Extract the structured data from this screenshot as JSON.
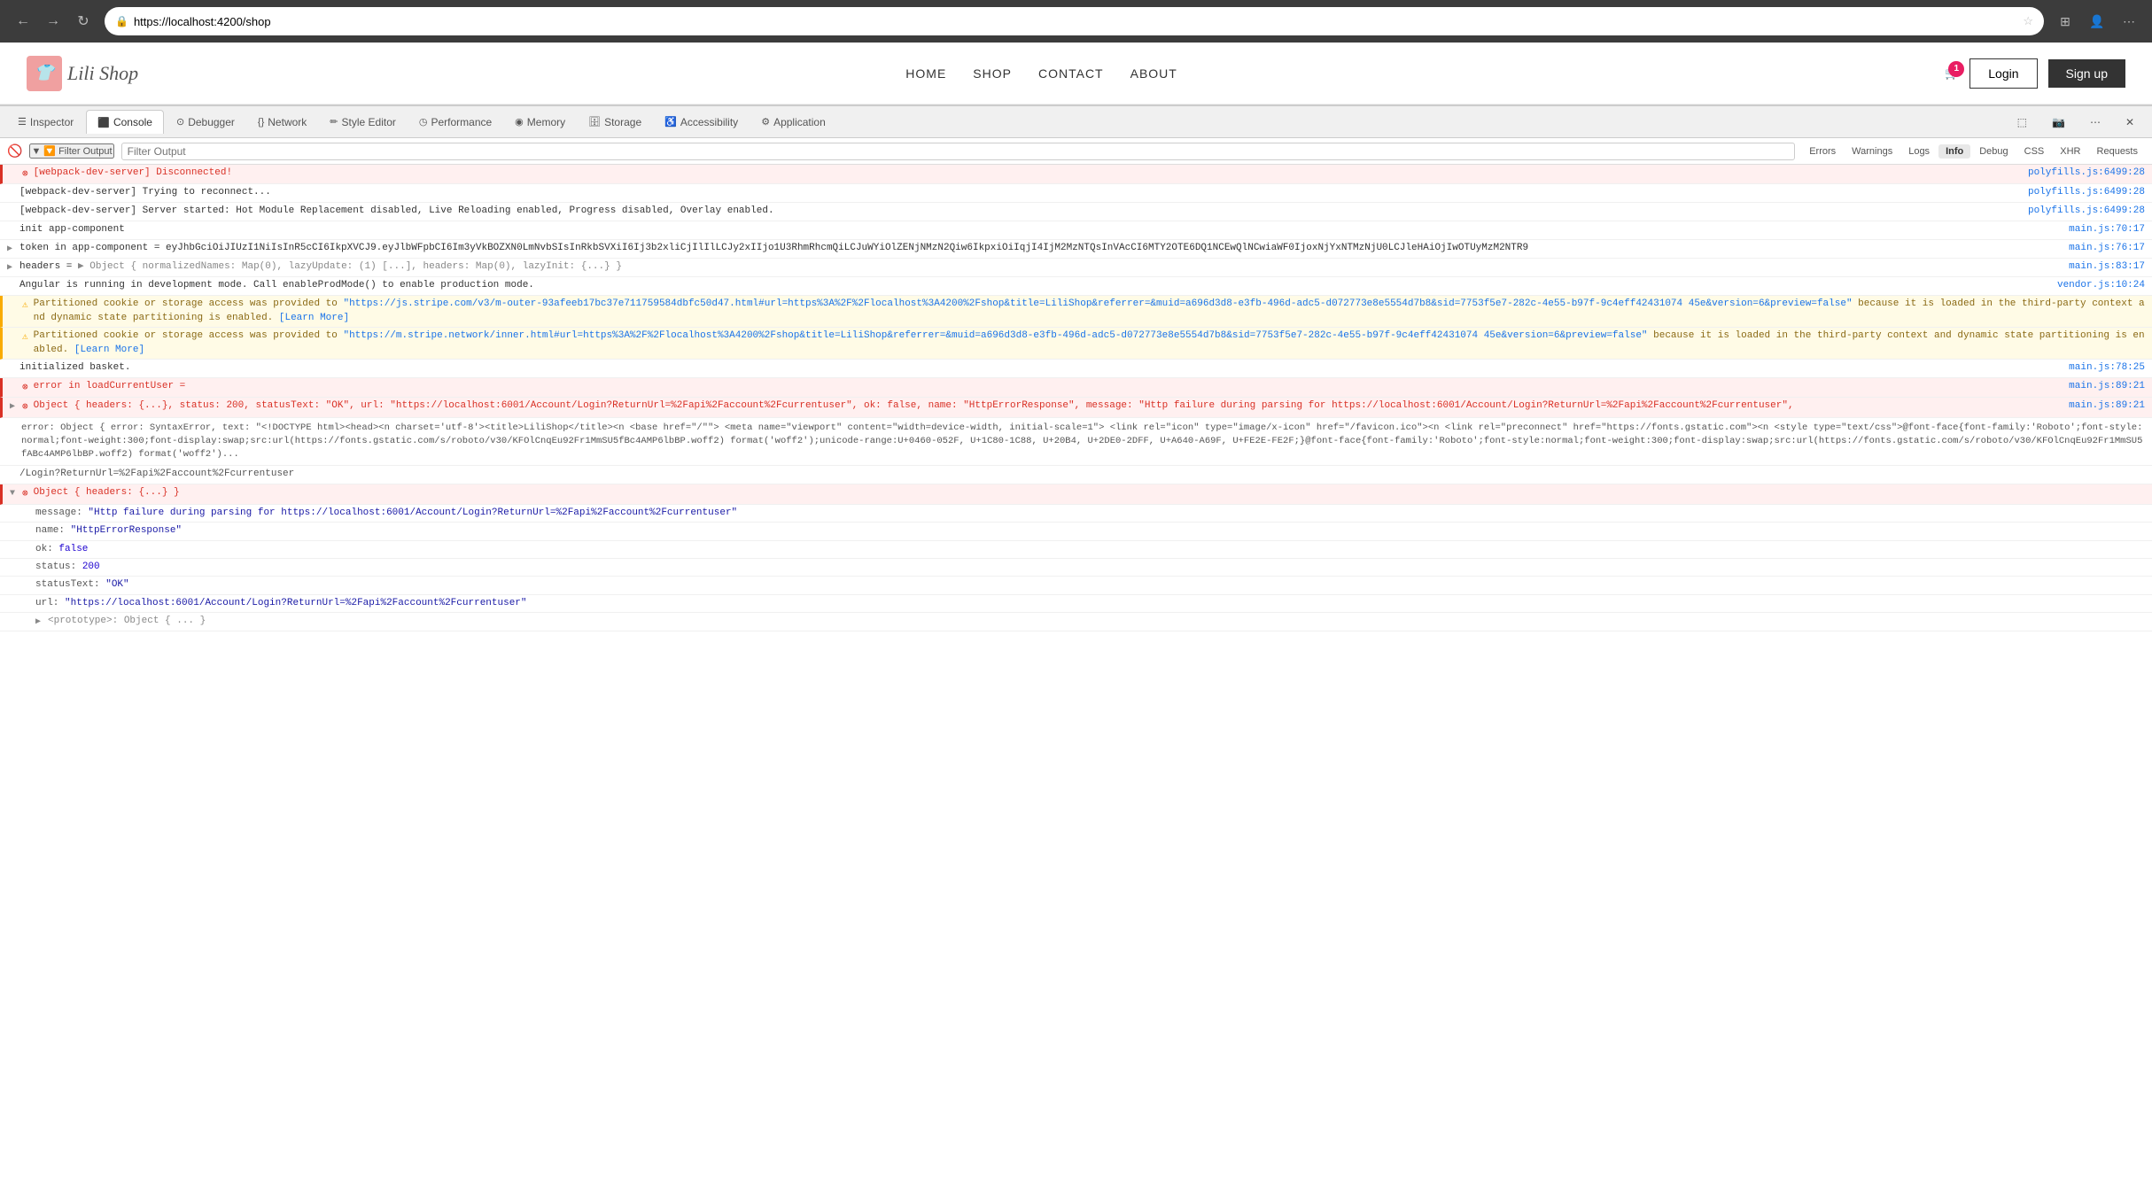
{
  "browser": {
    "url": "https://localhost:4200/shop",
    "back_label": "←",
    "forward_label": "→",
    "refresh_label": "↻",
    "star_label": "☆"
  },
  "site": {
    "logo_text": "Lili Shop",
    "logo_icon": "👕",
    "nav_items": [
      "HOME",
      "SHOP",
      "CONTACT",
      "ABOUT"
    ],
    "cart_count": "1",
    "login_label": "Login",
    "signup_label": "Sign up"
  },
  "devtools": {
    "tabs": [
      {
        "id": "inspector",
        "label": "Inspector",
        "icon": "☰"
      },
      {
        "id": "console",
        "label": "Console",
        "icon": "⬛",
        "active": true
      },
      {
        "id": "debugger",
        "label": "Debugger",
        "icon": "⊙"
      },
      {
        "id": "network",
        "label": "Network",
        "icon": "{}"
      },
      {
        "id": "style-editor",
        "label": "Style Editor",
        "icon": "✏"
      },
      {
        "id": "performance",
        "label": "Performance",
        "icon": "◷"
      },
      {
        "id": "memory",
        "label": "Memory",
        "icon": "◉"
      },
      {
        "id": "storage",
        "label": "Storage",
        "icon": "🗄"
      },
      {
        "id": "accessibility",
        "label": "Accessibility",
        "icon": "♿"
      },
      {
        "id": "application",
        "label": "Application",
        "icon": "⚙"
      }
    ],
    "sub_tabs": [
      {
        "id": "errors",
        "label": "Errors"
      },
      {
        "id": "warnings",
        "label": "Warnings"
      },
      {
        "id": "logs",
        "label": "Logs"
      },
      {
        "id": "info",
        "label": "Info",
        "active": true
      },
      {
        "id": "debug",
        "label": "Debug"
      },
      {
        "id": "css",
        "label": "CSS"
      },
      {
        "id": "xhr",
        "label": "XHR"
      },
      {
        "id": "requests",
        "label": "Requests"
      }
    ],
    "filter_label": "🔽 Filter Output"
  },
  "console_entries": [
    {
      "type": "error",
      "expandable": false,
      "icon": "⊗",
      "text": "[webpack-dev-server] Disconnected!",
      "source": "polyfills.js:6499:28"
    },
    {
      "type": "info",
      "expandable": false,
      "icon": "",
      "text": "[webpack-dev-server] Trying to reconnect...",
      "source": "polyfills.js:6499:28"
    },
    {
      "type": "info",
      "expandable": false,
      "icon": "",
      "text": "[webpack-dev-server] Server started: Hot Module Replacement disabled, Live Reloading enabled, Progress disabled, Overlay enabled.",
      "source": "polyfills.js:6499:28"
    },
    {
      "type": "info",
      "expandable": false,
      "icon": "",
      "text": "init app-component",
      "source": "main.js:70:17"
    },
    {
      "type": "info",
      "expandable": true,
      "icon": "",
      "text": "token in app-component = eyJhbGciOiJIUzI1NiIsInR5cCI6IkpXVCJ9.eyJlbWFpbCI6Im3yVkBOZXN0LmNvbSIsInRkbSVXiI6Ij3b2xliCjIlIlLCJy2xIIjo1U3RhmRhcmQiLCJuWYiOlZENjNMzN2Qiw6IkpxiOiIqjI4IjM2MzNTQsInVAcCI6MTY2OTE6DQ1NCEwQlNCwiaWF0IjoxNjYxNTMzNjU0LCJleHAiOjIwOTUyMzM2NTR9",
      "source": "main.js:76:17"
    },
    {
      "type": "info",
      "expandable": true,
      "icon": "",
      "text": "headers = ▶ Object { normalizedNames: Map(0), lazyUpdate: (1) [...], headers: Map(0), lazyInit: {...} }",
      "source": "main.js:83:17"
    },
    {
      "type": "info",
      "expandable": false,
      "icon": "",
      "text": "Angular is running in development mode. Call enableProdMode() to enable production mode.",
      "source": "vendor.js:10:24"
    },
    {
      "type": "warning",
      "expandable": false,
      "icon": "⚠",
      "text": "Partitioned cookie or storage access was provided to \"https://js.stripe.com/v3/m-outer-93afeeb17bc37e711759584dbfc50d47.html#url=https%3A%2F%2Flocalhost%3A4200%2Fshop&title=LiliShop&referrer=&muid=a696d3d8-e3fb-496d-adc5-d072773e8e5554d7b8&sid=7753f5e7-282c-4e55-b97f-9c4eff42431074 45e&version=6&preview=false\" because it is loaded in the third-party context and dynamic state partitioning is enabled. [Learn More]",
      "source": ""
    },
    {
      "type": "warning",
      "expandable": false,
      "icon": "⚠",
      "text": "Partitioned cookie or storage access was provided to \"https://m.stripe.network/inner.html#url=https%3A%2F%2Flocalhost%3A4200%2Fshop&title=LiliShop&referrer=&muid=a696d3d8-e3fb-496d-adc5-d072773e8e5554d7b8&sid=7753f5e7-282c-4e55-b97f-9c4eff42431074 45e&version=6&preview=false\" because it is loaded in the third-party context and dynamic state partitioning is enabled. [Learn More]",
      "source": ""
    },
    {
      "type": "info",
      "expandable": false,
      "icon": "",
      "text": "initialized basket.",
      "source": "main.js:78:25"
    },
    {
      "type": "error",
      "expandable": false,
      "icon": "⊗",
      "text": "error in loadCurrentUser =",
      "source": "main.js:89:21"
    },
    {
      "type": "error",
      "expandable": true,
      "icon": "⊗",
      "text": "▶ Object { headers: {...}, status: 200, statusText: \"OK\", url: \"https://localhost:6001/Account/Login?ReturnUrl=%2Fapi%2Faccount%2Fcurrentuser\", ok: false, name: \"HttpErrorResponse\", message: \"Http failure during parsing for https://localhost:6001/Account/Login?ReturnUrl=%2Fapi%2Faccount%2Fcurrentuser\",",
      "source": "main.js:89:21"
    },
    {
      "type": "long_html",
      "content": "error: Object { error: SyntaxError: text: \"<!DOCTYPE html><head><n charset='utf-8'><title>LiliShop</title><n <base href=\"/\"> <meta name=\"viewport\" content=\"width=device-width, initial-scale=1\"> <link rel=\"icon\" type=\"image/x-icon\" href=\"/favicon.ico\"><n <link rel=\"preconnect\" href=\"https://fonts.gstatic.com\"><n <style type=\"text/css\">@font-face{font-family:'Roboto';font-style:normal;font-weight:300;font-display:swap;src:url(https://fonts.gstatic.com/s/roboto/v30/KFOlCnqEu92Fr1MmSU5fBc4AMP6lbBP.woff2)...",
      "source": ""
    },
    {
      "type": "info",
      "expandable": false,
      "icon": "",
      "text": "/Login?ReturnUrl=%2Fapi%2Faccount%2Fcurrentuser",
      "source": ""
    },
    {
      "type": "error",
      "expandable": true,
      "icon": "⊗",
      "text": "▼ Object { headers: {...} }",
      "source": ""
    },
    {
      "type": "info",
      "expandable": false,
      "icon": "",
      "text": "  message: \"Http failure during parsing for https://localhost:6001/Account/Login?ReturnUrl=%2Fapi%2Faccount%2Fcurrentuser\"",
      "source": ""
    },
    {
      "type": "info",
      "expandable": false,
      "icon": "",
      "text": "  name: \"HttpErrorResponse\"",
      "source": ""
    },
    {
      "type": "info",
      "expandable": false,
      "icon": "",
      "text": "  ok: false",
      "source": ""
    },
    {
      "type": "info",
      "expandable": false,
      "icon": "",
      "text": "  status: 200",
      "source": ""
    },
    {
      "type": "info",
      "expandable": false,
      "icon": "",
      "text": "  statusText: \"OK\"",
      "source": ""
    },
    {
      "type": "info",
      "expandable": false,
      "icon": "",
      "text": "  url: \"https://localhost:6001/Account/Login?ReturnUrl=%2Fapi%2Faccount%2Fcurrentuser\"",
      "source": ""
    },
    {
      "type": "info",
      "expandable": true,
      "icon": "",
      "text": "▶ <prototype>: Object { ... }",
      "source": ""
    }
  ]
}
